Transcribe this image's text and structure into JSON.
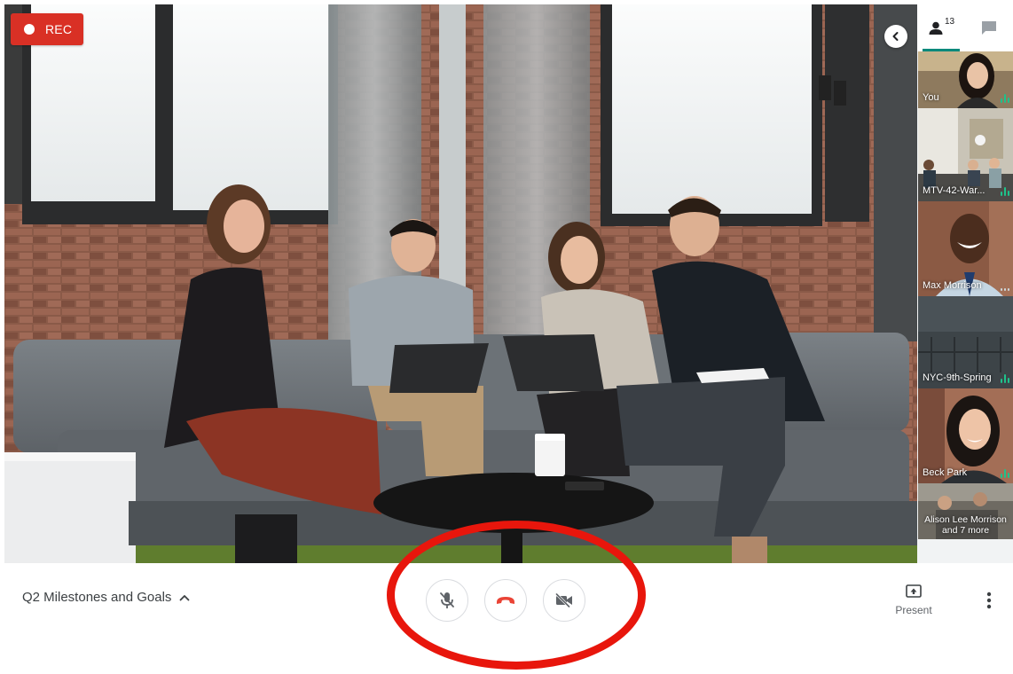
{
  "recording": {
    "label": "REC"
  },
  "sidebar": {
    "people_count": "13",
    "tiles": [
      {
        "name": "You",
        "speaking": true
      },
      {
        "name": "MTV-42-War...",
        "speaking": true
      },
      {
        "name": "Max Morrison",
        "speaking": false
      },
      {
        "name": "NYC-9th-Spring",
        "speaking": true
      },
      {
        "name": "Beck Park",
        "speaking": true
      },
      {
        "name_line1": "Alison Lee Morrison",
        "name_line2": "and 7 more"
      }
    ]
  },
  "bottom_bar": {
    "meeting_title": "Q2 Milestones and Goals",
    "present_label": "Present"
  },
  "colors": {
    "rec_red": "#d93025",
    "hangup_red": "#ea4335",
    "teal_accent": "#00897b",
    "annotation_red": "#e8160c",
    "speaking_green": "#1ec28b"
  },
  "icons": {
    "mic": "microphone-off-icon",
    "hangup": "phone-hangup-icon",
    "camera": "camera-off-icon",
    "present": "present-screen-icon",
    "more": "more-vertical-icon",
    "people": "people-icon",
    "chat": "chat-icon",
    "collapse": "chevron-left-icon"
  }
}
